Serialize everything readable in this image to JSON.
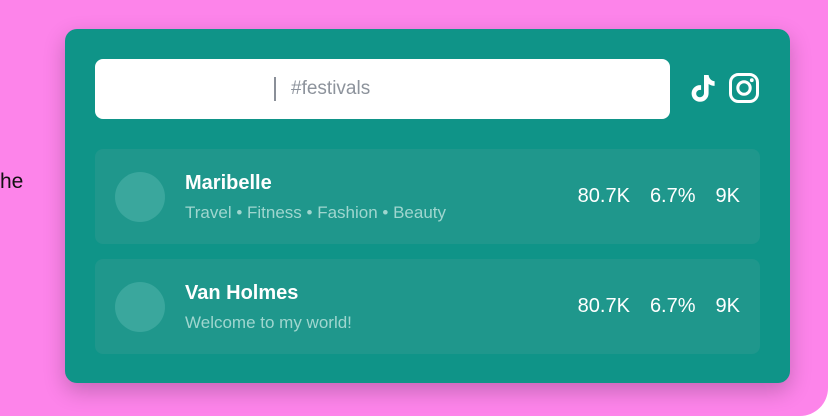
{
  "page": {
    "edge_text": "he"
  },
  "search": {
    "value": "",
    "placeholder": "#festivals"
  },
  "social": {
    "tiktok_icon": "tiktok-icon",
    "instagram_icon": "instagram-icon"
  },
  "creators": [
    {
      "name": "Maribelle",
      "subtitle": "Travel • Fitness • Fashion • Beauty",
      "followers": "80.7K",
      "engagement": "6.7%",
      "avg": "9K"
    },
    {
      "name": "Van Holmes",
      "subtitle": "Welcome to my world!",
      "followers": "80.7K",
      "engagement": "6.7%",
      "avg": "9K"
    }
  ],
  "colors": {
    "page_background": "#fd84ea",
    "card_background": "#0f9488",
    "row_background": "#1f978c",
    "avatar_placeholder": "#3aa79d",
    "subtitle_text": "#9fd6cf"
  }
}
